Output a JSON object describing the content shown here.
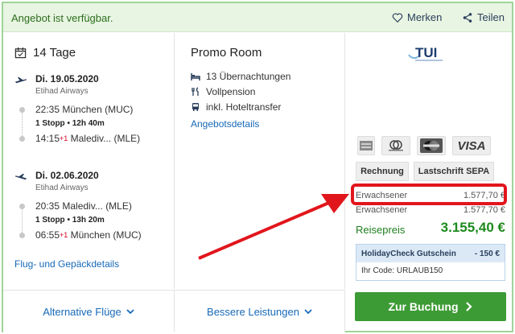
{
  "header": {
    "availability": "Angebot ist verfügbar.",
    "remember_label": "Merken",
    "share_label": "Teilen"
  },
  "trip": {
    "duration": "14 Tage",
    "outbound": {
      "date": "Di. 19.05.2020",
      "airline": "Etihad Airways",
      "depart_time": "22:35",
      "depart_airport": "München (MUC)",
      "stops": "1 Stopp  •  12h 40m",
      "arrive_time": "14:15",
      "arrive_plus": "+1",
      "arrive_place": "Malediv...",
      "arrive_code": "(MLE)"
    },
    "inbound": {
      "date": "Di. 02.06.2020",
      "airline": "Etihad Airways",
      "depart_time": "20:35",
      "depart_place": "Malediv...",
      "depart_code": "(MLE)",
      "stops": "1 Stopp  •  13h 20m",
      "arrive_time": "06:55",
      "arrive_plus": "+1",
      "arrive_airport": "München (MUC)"
    },
    "details_link": "Flug- und Gepäckdetails"
  },
  "room": {
    "title": "Promo Room",
    "features": [
      "13 Übernachtungen",
      "Vollpension",
      "inkl. Hoteltransfer"
    ],
    "offer_link": "Angebotsdetails"
  },
  "booking": {
    "brand": "TUI",
    "payment_icons": [
      "amex-card-icon",
      "diners-club-icon",
      "mastercard-icon",
      "visa-icon"
    ],
    "visa_label": "VISA",
    "invoice_label": "Rechnung",
    "sepa_label": "Lastschrift SEPA",
    "adult1_label": "Erwachsener",
    "adult1_price": "1.577,70 €",
    "adult2_label": "Erwachsener",
    "adult2_price": "1.577,70 €",
    "total_label": "Reisepreis",
    "total_price": "3.155,40 €",
    "voucher_title": "HolidayCheck Gutschein",
    "voucher_amount": "- 150 €",
    "voucher_code": "Ihr Code: URLAUB150",
    "book_button": "Zur Buchung"
  },
  "footer": {
    "alt_flights": "Alternative Flüge",
    "better_services": "Bessere Leistungen"
  },
  "colors": {
    "accent_green": "#3d9b35",
    "link_blue": "#1769b8",
    "highlight_red": "#e1161c",
    "header_bg": "#e8f5e2"
  }
}
